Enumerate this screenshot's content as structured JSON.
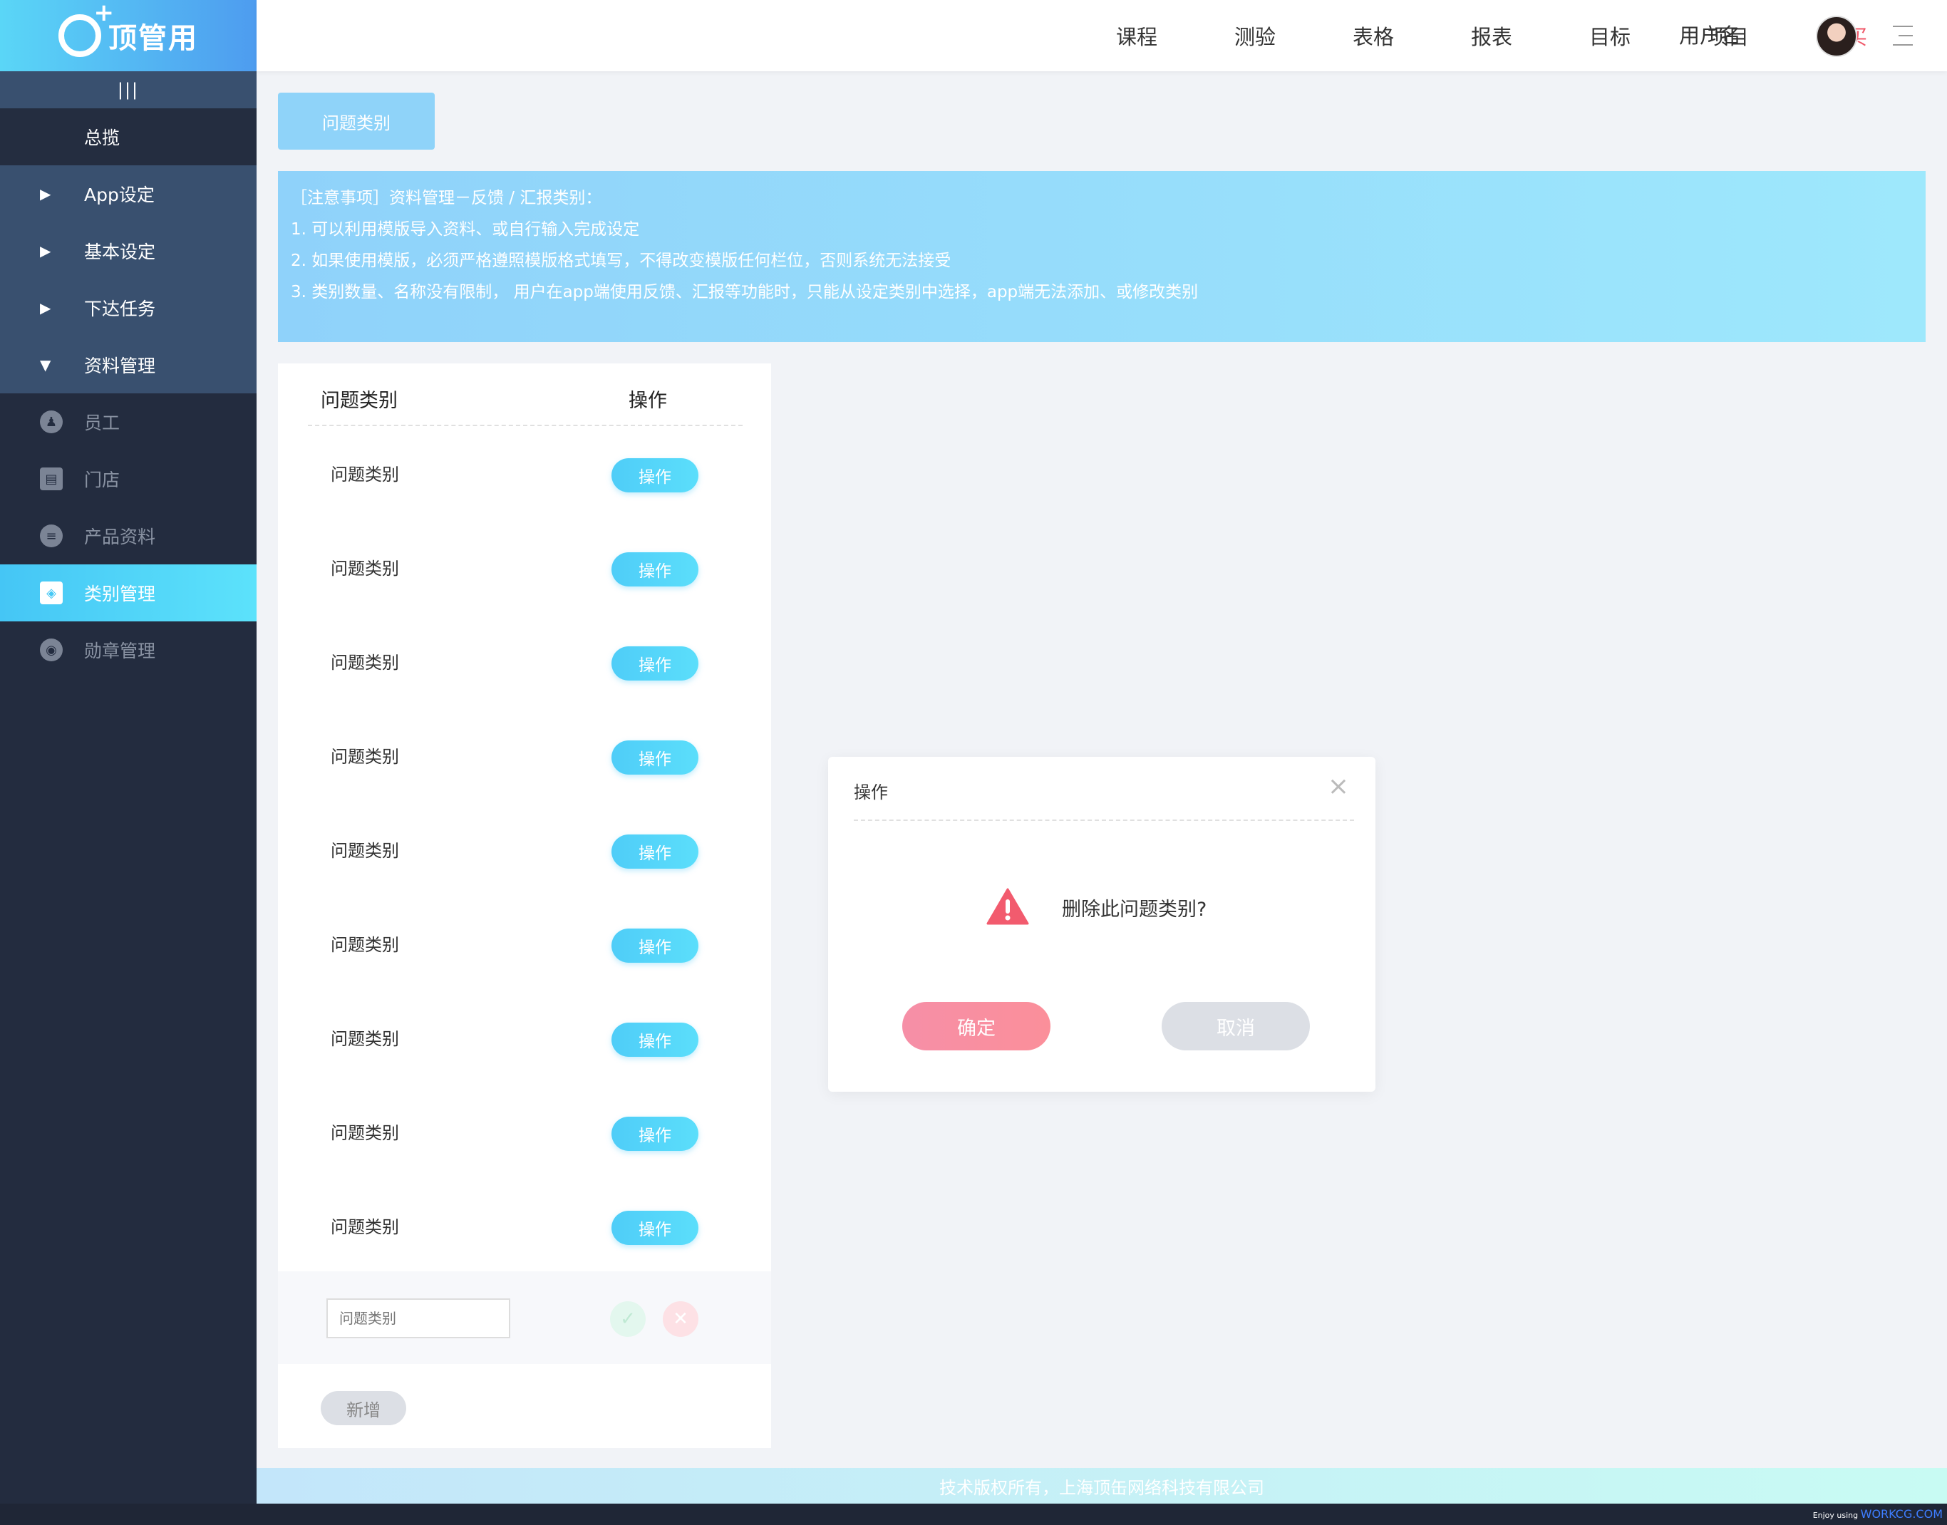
{
  "app": {
    "logo_text": "顶管用"
  },
  "sidebar": {
    "collapse_label": "|||",
    "items": [
      {
        "label": "总揽"
      },
      {
        "label": "App设定"
      },
      {
        "label": "基本设定"
      },
      {
        "label": "下达任务"
      },
      {
        "label": "资料管理"
      },
      {
        "label": "员工",
        "icon": "person-icon"
      },
      {
        "label": "门店",
        "icon": "store-icon"
      },
      {
        "label": "产品资料",
        "icon": "document-icon"
      },
      {
        "label": "类别管理",
        "icon": "layers-icon"
      },
      {
        "label": "勋章管理",
        "icon": "medal-icon"
      }
    ]
  },
  "header": {
    "menu": [
      "课程",
      "测验",
      "表格",
      "报表",
      "目标",
      "项目",
      "购买"
    ],
    "username": "用户名"
  },
  "tab": {
    "label": "问题类别"
  },
  "notice": {
    "lines": [
      "［注意事项］资料管理－反馈 / 汇报类别：",
      "1. 可以利用模版导入资料、或自行输入完成设定",
      "2. 如果使用模版，必须严格遵照模版格式填写，不得改变模版任何栏位，否则系统无法接受",
      "3. 类别数量、名称没有限制， 用户在app端使用反馈、汇报等功能时，只能从设定类别中选择，app端无法添加、或修改类别"
    ]
  },
  "table": {
    "headers": [
      "问题类别",
      "操作"
    ],
    "rows": [
      {
        "name": "问题类别",
        "action": "操作"
      },
      {
        "name": "问题类别",
        "action": "操作"
      },
      {
        "name": "问题类别",
        "action": "操作"
      },
      {
        "name": "问题类别",
        "action": "操作"
      },
      {
        "name": "问题类别",
        "action": "操作"
      },
      {
        "name": "问题类别",
        "action": "操作"
      },
      {
        "name": "问题类别",
        "action": "操作"
      },
      {
        "name": "问题类别",
        "action": "操作"
      },
      {
        "name": "问题类别",
        "action": "操作"
      }
    ],
    "input_placeholder": "问题类别",
    "add_label": "新增"
  },
  "modal": {
    "title": "操作",
    "message": "删除此问题类别?",
    "confirm": "确定",
    "cancel": "取消"
  },
  "footer": {
    "text": "技术版权所有，上海顶缶网络科技有限公司"
  },
  "credit": {
    "prefix": "Enjoy using",
    "brand": "WORKCG.COM"
  },
  "colors": {
    "accent": "#4fcdf8",
    "danger": "#f05a6b",
    "sidebar": "#232c3f"
  }
}
